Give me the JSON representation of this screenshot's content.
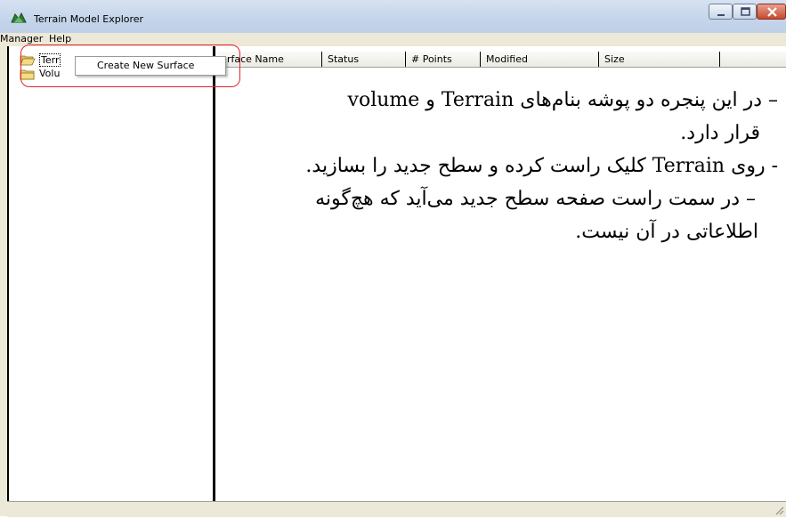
{
  "window": {
    "title": "Terrain Model Explorer",
    "icon": "terrain-tree-icon"
  },
  "menu": {
    "items": [
      "Manager",
      "Help"
    ]
  },
  "tree": {
    "items": [
      {
        "label": "Terrain",
        "visible_label": "Terr",
        "icon": "folder-open-icon",
        "selected": true
      },
      {
        "label": "Volume",
        "visible_label": "Volu",
        "icon": "folder-icon",
        "selected": false
      }
    ]
  },
  "context_menu": {
    "items": [
      "Create New Surface"
    ]
  },
  "list": {
    "columns": [
      "urface Name",
      "Status",
      "# Points",
      "Modified",
      "Size"
    ]
  },
  "overlay": {
    "lines": [
      "– در این پنجره دو پوشه بنام‌های  Terrain و volume",
      "قرار دارد.",
      "- روی Terrain کلیک راست کرده و سطح جدید را بسازید.",
      "– در سمت راست صفحه سطح جدید می‌آید که هچ‌گونه",
      "اطلاعاتی در آن نیست."
    ]
  },
  "colors": {
    "annotation": "#e0242b",
    "title_bar": "#c4d4ea",
    "close_button": "#c74a2e"
  }
}
